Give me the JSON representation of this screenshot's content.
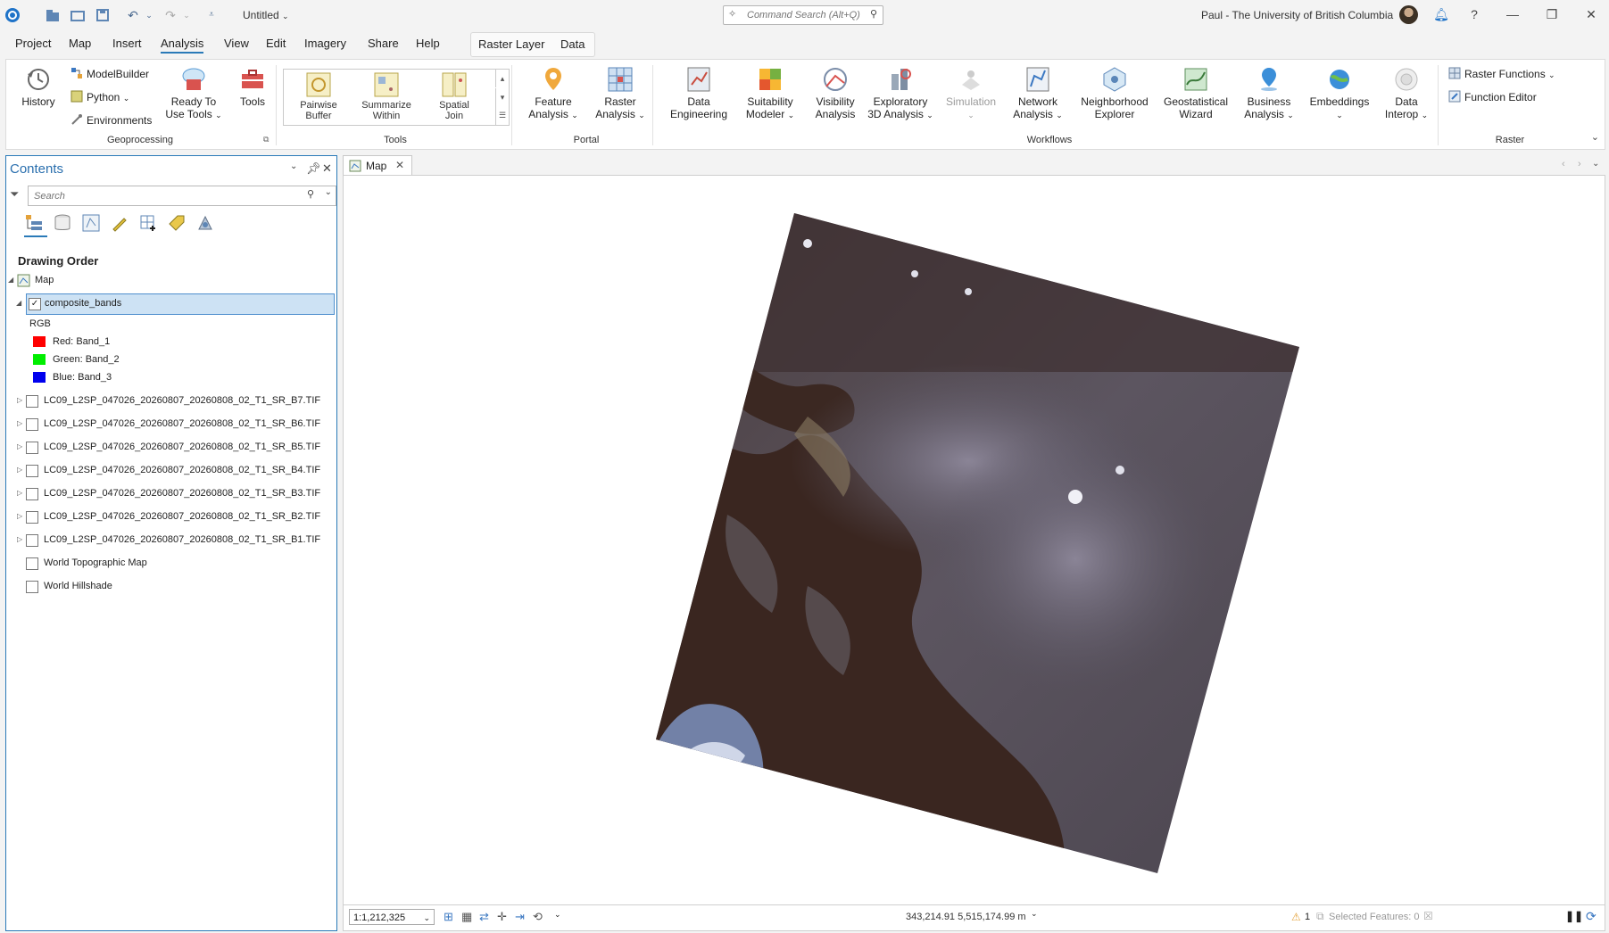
{
  "app": {
    "doc_title": "Untitled",
    "command_search_placeholder": "Command Search (Alt+Q)",
    "user": "Paul - The University of British Columbia"
  },
  "menu_tabs": [
    "Project",
    "Map",
    "Insert",
    "Analysis",
    "View",
    "Edit",
    "Imagery",
    "Share",
    "Help"
  ],
  "context_tabs": [
    "Raster Layer",
    "Data"
  ],
  "ribbon": {
    "geoprocessing": {
      "label": "Geoprocessing",
      "history": "History",
      "modelbuilder": "ModelBuilder",
      "python": "Python",
      "environments": "Environments",
      "ready_to_use_1": "Ready To",
      "ready_to_use_2": "Use Tools",
      "tools": "Tools"
    },
    "tools": {
      "label": "Tools",
      "items": [
        {
          "l1": "Pairwise",
          "l2": "Buffer"
        },
        {
          "l1": "Summarize",
          "l2": "Within"
        },
        {
          "l1": "Spatial",
          "l2": "Join"
        }
      ]
    },
    "portal": {
      "label": "Portal",
      "feature_1": "Feature",
      "feature_2": "Analysis",
      "raster_1": "Raster",
      "raster_2": "Analysis"
    },
    "workflows": {
      "label": "Workflows",
      "items": [
        {
          "l1": "Data",
          "l2": "Engineering"
        },
        {
          "l1": "Suitability",
          "l2": "Modeler"
        },
        {
          "l1": "Visibility",
          "l2": "Analysis"
        },
        {
          "l1": "Exploratory",
          "l2": "3D Analysis"
        },
        {
          "l1": "Simulation",
          "l2": ""
        },
        {
          "l1": "Network",
          "l2": "Analysis"
        },
        {
          "l1": "Neighborhood",
          "l2": "Explorer"
        },
        {
          "l1": "Geostatistical",
          "l2": "Wizard"
        },
        {
          "l1": "Business",
          "l2": "Analysis"
        },
        {
          "l1": "Embeddings",
          "l2": ""
        },
        {
          "l1": "Data",
          "l2": "Interop"
        }
      ]
    },
    "raster": {
      "label": "Raster",
      "raster_functions": "Raster Functions",
      "function_editor": "Function Editor"
    }
  },
  "contents": {
    "title": "Contents",
    "search_placeholder": "Search",
    "drawing_order": "Drawing Order",
    "map_label": "Map",
    "composite": "composite_bands",
    "rgb": "RGB",
    "bands": [
      {
        "label": "Red:",
        "value": "Band_1",
        "color": "#ff0000"
      },
      {
        "label": "Green:",
        "value": "Band_2",
        "color": "#00ee00"
      },
      {
        "label": "Blue:",
        "value": "Band_3",
        "color": "#0000ee"
      }
    ],
    "layers": [
      "LC09_L2SP_047026_20260807_20260808_02_T1_SR_B7.TIF",
      "LC09_L2SP_047026_20260807_20260808_02_T1_SR_B6.TIF",
      "LC09_L2SP_047026_20260807_20260808_02_T1_SR_B5.TIF",
      "LC09_L2SP_047026_20260807_20260808_02_T1_SR_B4.TIF",
      "LC09_L2SP_047026_20260807_20260808_02_T1_SR_B3.TIF",
      "LC09_L2SP_047026_20260807_20260808_02_T1_SR_B2.TIF",
      "LC09_L2SP_047026_20260807_20260808_02_T1_SR_B1.TIF"
    ],
    "basemaps": [
      "World Topographic Map",
      "World Hillshade"
    ]
  },
  "map_view": {
    "tab": "Map",
    "scale": "1:1,212,325",
    "coordinates": "343,214.91 5,515,174.99 m",
    "warnings": "1",
    "selected_features": "Selected Features: 0"
  },
  "colors": {
    "accent": "#2a7ab8",
    "selection": "#cde2f4",
    "imagery_dark": "#3a2a24",
    "imagery_light": "#6a6070"
  }
}
